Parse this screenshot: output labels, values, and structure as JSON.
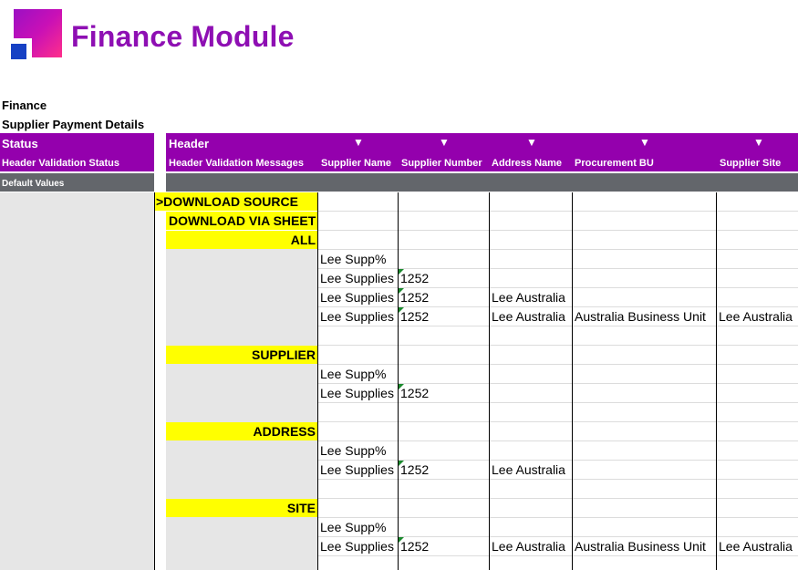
{
  "brand": {
    "title": "Finance Module"
  },
  "titles": {
    "line1": "Finance",
    "line2": "Supplier Payment Details"
  },
  "headers": {
    "status": "Status",
    "header": "Header",
    "status_sub": "Header Validation Status",
    "messages_sub": "Header Validation Messages",
    "columns": [
      "Supplier Name",
      "Supplier Number",
      "Address Name",
      "Procurement BU",
      "Supplier Site"
    ]
  },
  "default_values": "Default Values",
  "sections": {
    "download_source": ">DOWNLOAD SOURCE",
    "download_via_sheet": "DOWNLOAD VIA SHEET",
    "all": "ALL",
    "supplier": "SUPPLIER",
    "address": "ADDRESS",
    "site": "SITE"
  },
  "rows": {
    "supp_wild": "Lee Supp%",
    "supp_name": "Lee Supplies",
    "supp_num": "1252",
    "address": "Lee Australia",
    "bu": "Australia Business Unit",
    "site": "Lee Australia"
  }
}
